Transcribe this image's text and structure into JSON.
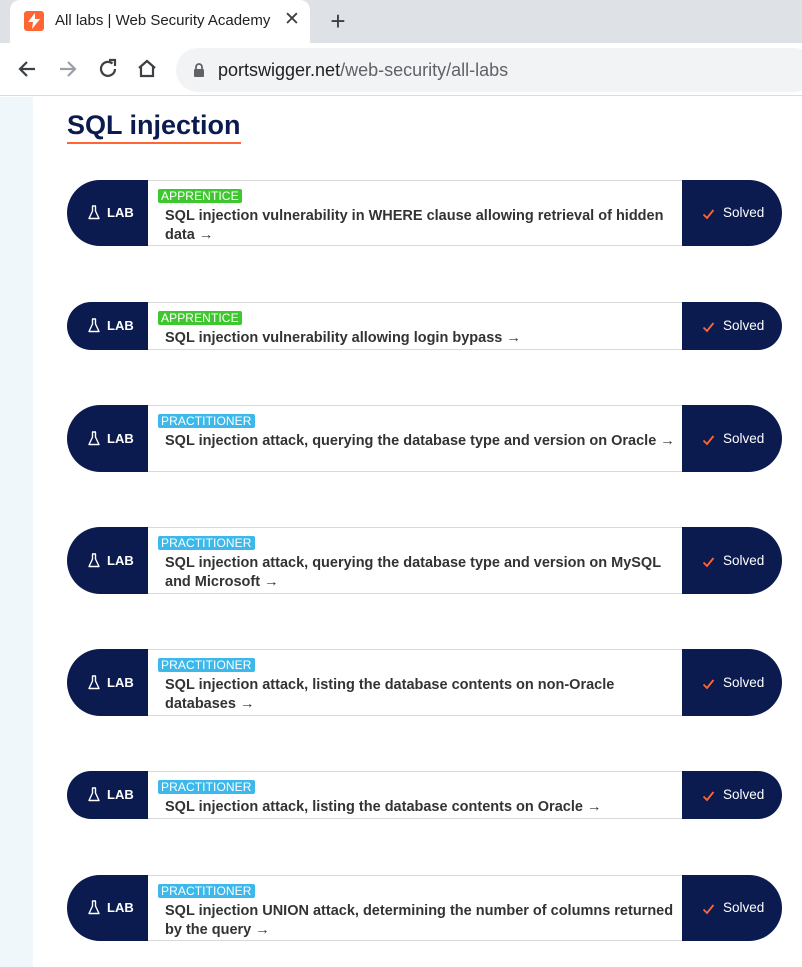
{
  "browser": {
    "tab_title": "All labs | Web Security Academy",
    "url_host": "portswigger.net",
    "url_path": "/web-security/all-labs"
  },
  "section_title": "SQL injection",
  "labs": [
    {
      "level": "APPRENTICE",
      "title": "SQL injection vulnerability in WHERE clause allowing retrieval of hidden data",
      "arrow": "→",
      "status": "Solved",
      "tag": "LAB"
    },
    {
      "level": "APPRENTICE",
      "title": "SQL injection vulnerability allowing login bypass",
      "arrow": "→",
      "status": "Solved",
      "tag": "LAB"
    },
    {
      "level": "PRACTITIONER",
      "title": "SQL injection attack, querying the database type and version on Oracle",
      "arrow": "→",
      "status": "Solved",
      "tag": "LAB"
    },
    {
      "level": "PRACTITIONER",
      "title": "SQL injection attack, querying the database type and version on MySQL and Microsoft",
      "arrow": "→",
      "status": "Solved",
      "tag": "LAB"
    },
    {
      "level": "PRACTITIONER",
      "title": "SQL injection attack, listing the database contents on non-Oracle databases",
      "arrow": "→",
      "status": "Solved",
      "tag": "LAB"
    },
    {
      "level": "PRACTITIONER",
      "title": "SQL injection attack, listing the database contents on Oracle",
      "arrow": "→",
      "status": "Solved",
      "tag": "LAB"
    },
    {
      "level": "PRACTITIONER",
      "title": "SQL injection UNION attack, determining the number of columns returned by the query",
      "arrow": "→",
      "status": "Solved",
      "tag": "LAB"
    }
  ],
  "colors": {
    "navy": "#0b1a4f",
    "accent_orange": "#ff6633",
    "apprentice_green": "#3fc72f",
    "practitioner_blue": "#3db8ea"
  }
}
